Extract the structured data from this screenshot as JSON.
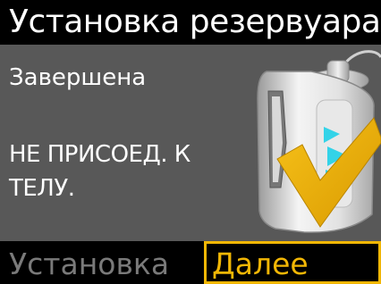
{
  "header": {
    "title": "Установка резервуара"
  },
  "main": {
    "status": "Завершена",
    "warning": "НЕ ПРИСОЕД. К ТЕЛУ."
  },
  "softkeys": {
    "left_label": "Установка",
    "right_label": "Далее"
  },
  "colors": {
    "background": "#585858",
    "bar": "#000000",
    "text": "#ffffff",
    "accent": "#f2b705",
    "arrow": "#33d3e8",
    "disabled": "#7a7a7a"
  },
  "icons": {
    "illustration": "reservoir-inserted-checkmark-icon"
  }
}
